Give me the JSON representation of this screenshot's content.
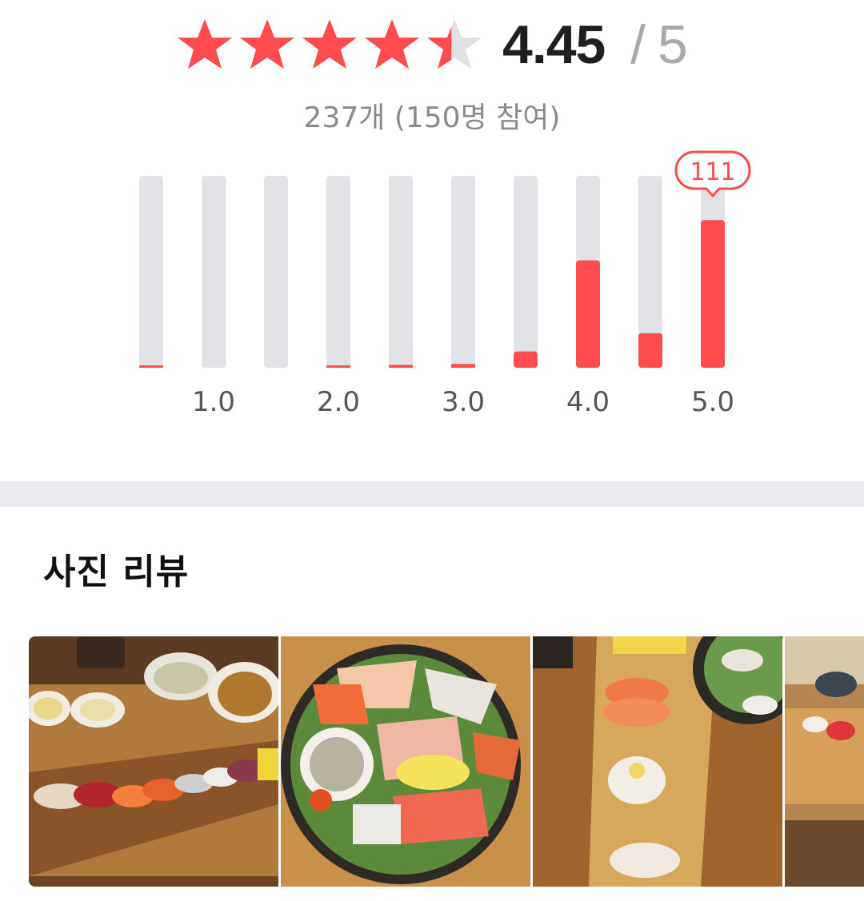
{
  "rating": {
    "score": "4.45",
    "separator": "/",
    "max": "5",
    "score_value": 4.45,
    "star_count": 5,
    "count_text": "237개 (150명 참여)"
  },
  "chart_data": {
    "type": "bar",
    "bars": [
      {
        "rating": 0.5,
        "value": 0.01
      },
      {
        "rating": 1.0,
        "value": 0
      },
      {
        "rating": 1.5,
        "value": 0
      },
      {
        "rating": 2.0,
        "value": 0.01
      },
      {
        "rating": 2.5,
        "value": 0.015
      },
      {
        "rating": 3.0,
        "value": 0.02
      },
      {
        "rating": 3.5,
        "value": 0.085
      },
      {
        "rating": 4.0,
        "value": 0.56
      },
      {
        "rating": 4.5,
        "value": 0.18
      },
      {
        "rating": 5.0,
        "value": 0.77
      }
    ],
    "tick_labels": [
      "1.0",
      "2.0",
      "3.0",
      "4.0",
      "5.0"
    ],
    "highlight_label": "111",
    "accent_color": "#ff4d4f",
    "track_color": "#e1e3e7"
  },
  "photo_review": {
    "title": "사진 리뷰",
    "photos": [
      {
        "name": "sushi-platter-photo"
      },
      {
        "name": "sashimi-bowl-photo"
      },
      {
        "name": "sushi-board-photo"
      },
      {
        "name": "sushi-table-photo"
      }
    ]
  },
  "colors": {
    "accent": "#ff4d4f",
    "star_empty": "#dfe1e5",
    "divider": "#e9ebee"
  }
}
